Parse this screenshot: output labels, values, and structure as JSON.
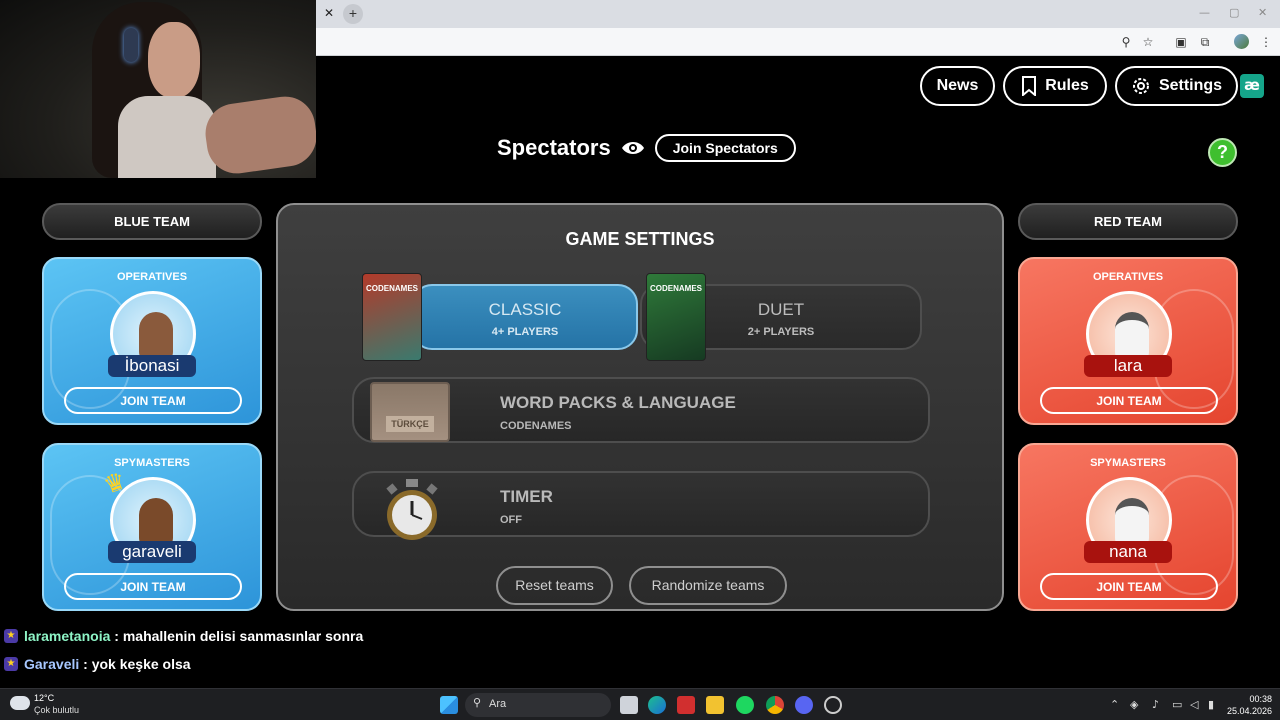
{
  "header": {
    "news_label": "News",
    "rules_label": "Rules",
    "settings_label": "Settings",
    "logo_text": "æ"
  },
  "spectators": {
    "title": "Spectators",
    "join_label": "Join Spectators",
    "help_label": "?"
  },
  "blue_team": {
    "label": "BLUE TEAM",
    "operatives": {
      "title": "OPERATIVES",
      "player": "İbonasi",
      "join_label": "JOIN TEAM"
    },
    "spymasters": {
      "title": "SPYMASTERS",
      "player": "garaveli",
      "join_label": "JOIN TEAM"
    }
  },
  "red_team": {
    "label": "RED TEAM",
    "operatives": {
      "title": "OPERATIVES",
      "player": "lara",
      "join_label": "JOIN TEAM"
    },
    "spymasters": {
      "title": "SPYMASTERS",
      "player": "nana",
      "join_label": "JOIN TEAM"
    }
  },
  "game_settings": {
    "title": "GAME SETTINGS",
    "modes": [
      {
        "name": "CLASSIC",
        "players": "4+ PLAYERS",
        "box_title": "CODENAMES",
        "selected": true
      },
      {
        "name": "DUET",
        "players": "2+ PLAYERS",
        "box_title": "CODENAMES",
        "selected": false
      }
    ],
    "word_packs": {
      "title": "WORD PACKS & LANGUAGE",
      "value": "CODENAMES",
      "language_box": "TÜRKÇE"
    },
    "timer": {
      "title": "TIMER",
      "value": "OFF"
    },
    "reset_label": "Reset teams",
    "randomize_label": "Randomize teams"
  },
  "chat": [
    {
      "user": "larametanoia",
      "separator": " : ",
      "message": "mahallenin delisi sanmasınlar sonra"
    },
    {
      "user": "Garaveli",
      "separator": " : ",
      "message": "yok keşke olsa"
    }
  ],
  "taskbar": {
    "temperature": "12°C",
    "condition": "Çok bulutlu",
    "search_placeholder": "Ara",
    "time": "00:38",
    "date": "25.04.2026"
  },
  "colors": {
    "blue_team": "#3aa8e8",
    "red_team": "#ee5a44",
    "classic_mode": "#2f82b5",
    "help_button": "#3fbf2f"
  }
}
